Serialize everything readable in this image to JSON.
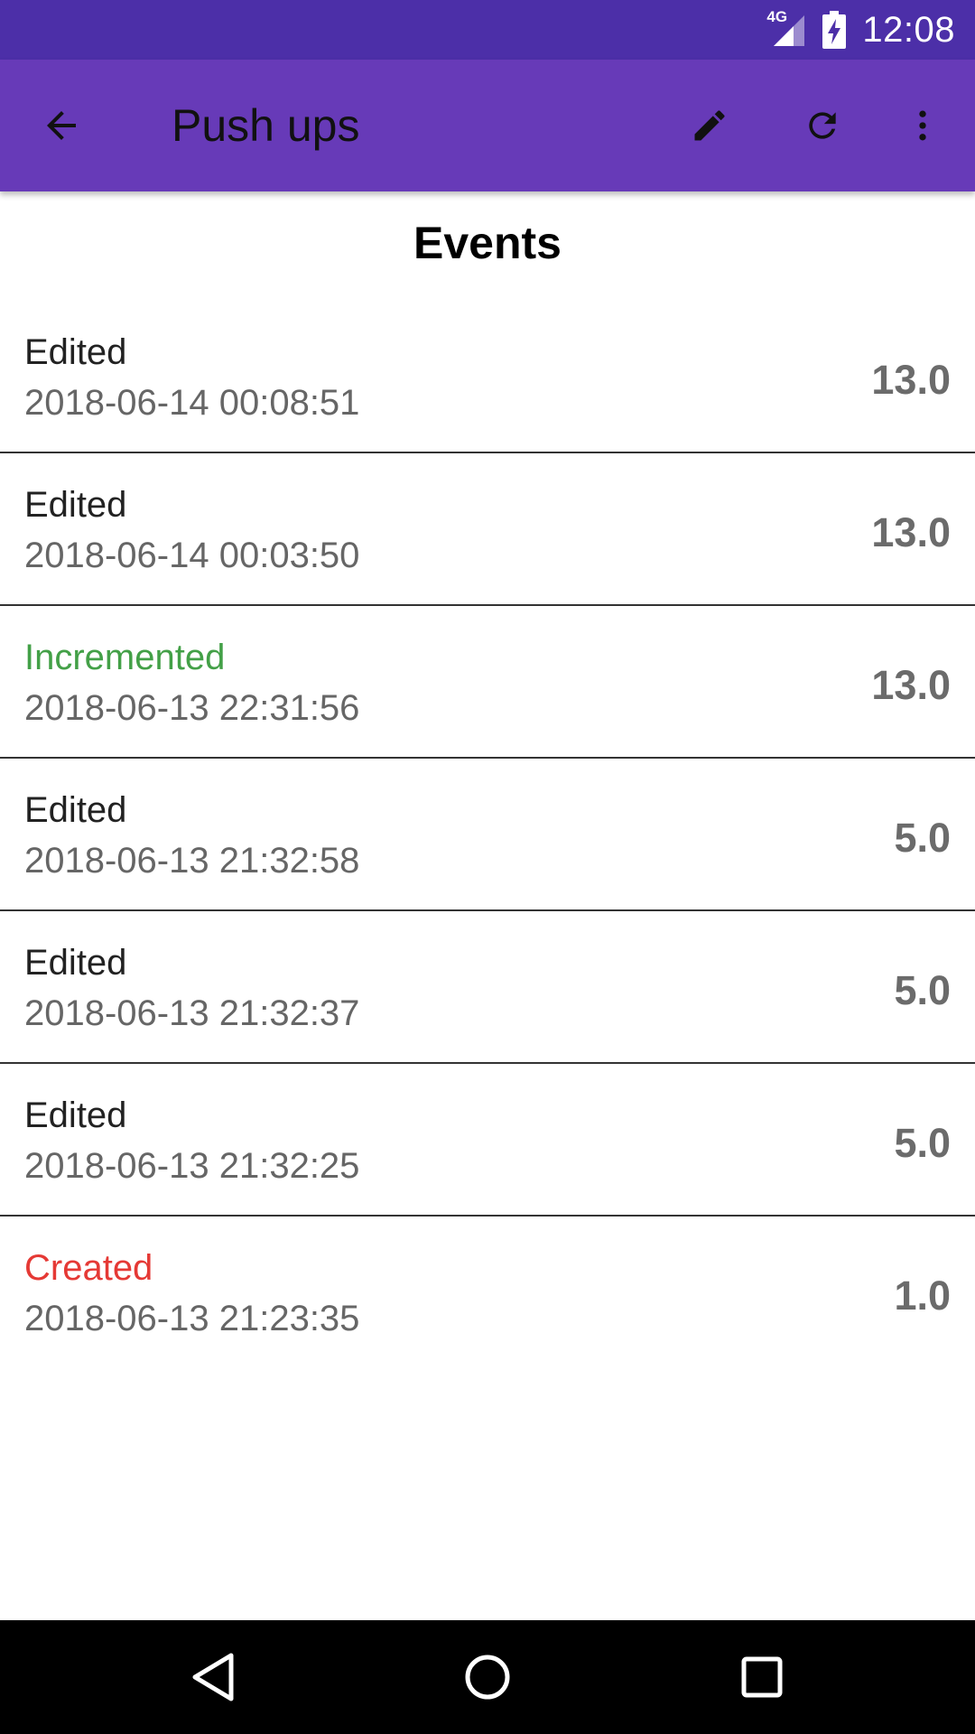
{
  "status_bar": {
    "time": "12:08",
    "network": "4G",
    "icons": [
      "signal-icon",
      "battery-charging-icon"
    ],
    "background": "#4c2fa8"
  },
  "app_bar": {
    "title": "Push ups",
    "background": "#673ab8",
    "actions": [
      "back-arrow-icon",
      "edit-pencil-icon",
      "refresh-icon",
      "more-vert-icon"
    ]
  },
  "section": {
    "title": "Events"
  },
  "colors": {
    "default_kind": "#222222",
    "incremented": "#43a047",
    "created": "#e53935",
    "value": "#6b6b6b"
  },
  "events": [
    {
      "kind": "Edited",
      "time": "2018-06-14 00:08:51",
      "value": "13.0",
      "color": "#222222"
    },
    {
      "kind": "Edited",
      "time": "2018-06-14 00:03:50",
      "value": "13.0",
      "color": "#222222"
    },
    {
      "kind": "Incremented",
      "time": "2018-06-13 22:31:56",
      "value": "13.0",
      "color": "#43a047"
    },
    {
      "kind": "Edited",
      "time": "2018-06-13 21:32:58",
      "value": "5.0",
      "color": "#222222"
    },
    {
      "kind": "Edited",
      "time": "2018-06-13 21:32:37",
      "value": "5.0",
      "color": "#222222"
    },
    {
      "kind": "Edited",
      "time": "2018-06-13 21:32:25",
      "value": "5.0",
      "color": "#222222"
    },
    {
      "kind": "Created",
      "time": "2018-06-13 21:23:35",
      "value": "1.0",
      "color": "#e53935"
    }
  ],
  "nav_bar": {
    "buttons": [
      "nav-back-icon",
      "nav-home-icon",
      "nav-recents-icon"
    ]
  }
}
